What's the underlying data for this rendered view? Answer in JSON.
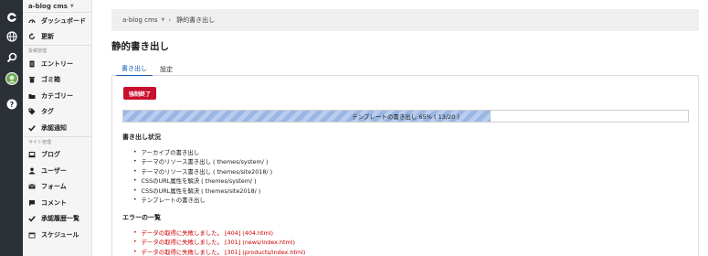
{
  "app": {
    "name": "a-blog cms"
  },
  "sidebar": {
    "top_items": [
      {
        "label": "ダッシュボード",
        "icon": "dashboard-icon"
      },
      {
        "label": "更新",
        "icon": "refresh-icon"
      }
    ],
    "section1": {
      "label": "投稿管理",
      "items": [
        {
          "label": "エントリー",
          "icon": "document-icon"
        },
        {
          "label": "ゴミ箱",
          "icon": "trash-icon"
        },
        {
          "label": "カテゴリー",
          "icon": "folder-icon"
        },
        {
          "label": "タグ",
          "icon": "tag-icon"
        },
        {
          "label": "承認通知",
          "icon": "check-icon"
        }
      ]
    },
    "section2": {
      "label": "サイト管理",
      "items": [
        {
          "label": "ブログ",
          "icon": "laptop-icon"
        },
        {
          "label": "ユーザー",
          "icon": "user-icon"
        },
        {
          "label": "フォーム",
          "icon": "mail-icon"
        },
        {
          "label": "コメント",
          "icon": "comment-icon"
        },
        {
          "label": "承認履歴一覧",
          "icon": "check-icon"
        },
        {
          "label": "スケジュール",
          "icon": "calendar-icon"
        }
      ]
    }
  },
  "rail": {
    "icons": [
      "a-blog-logo-icon",
      "globe-icon",
      "search-icon",
      "avatar",
      "help-icon"
    ]
  },
  "breadcrumb": {
    "root": "a-blog cms",
    "current": "静的書き出し"
  },
  "page": {
    "title": "静的書き出し"
  },
  "tabs": [
    {
      "label": "書き出し",
      "active": true
    },
    {
      "label": "設定",
      "active": false
    }
  ],
  "actions": {
    "stop_label": "強制終了",
    "stop_color": "#c8102e"
  },
  "progress": {
    "label": "テンプレートの書き出し 65% ( 13/20 )",
    "percent": 65
  },
  "status": {
    "heading": "書き出し状況",
    "items": [
      "アーカイブの書き出し",
      "テーマのリソース書き出し ( themes/system/ )",
      "テーマのリソース書き出し ( themes/site2018/ )",
      "CSSのURL属性を解決 ( themes/system/ )",
      "CSSのURL属性を解決 ( themes/site2018/ )",
      "テンプレートの書き出し"
    ]
  },
  "errors": {
    "heading": "エラーの一覧",
    "items": [
      "データの取得に失敗しました。 [404] (404.html)",
      "データの取得に失敗しました。 [301] (news/index.html)",
      "データの取得に失敗しました。 [301] (products/index.html)"
    ]
  },
  "colors": {
    "accent": "#1a5fb4",
    "error": "#cc0000",
    "rail": "#2b2f36"
  }
}
